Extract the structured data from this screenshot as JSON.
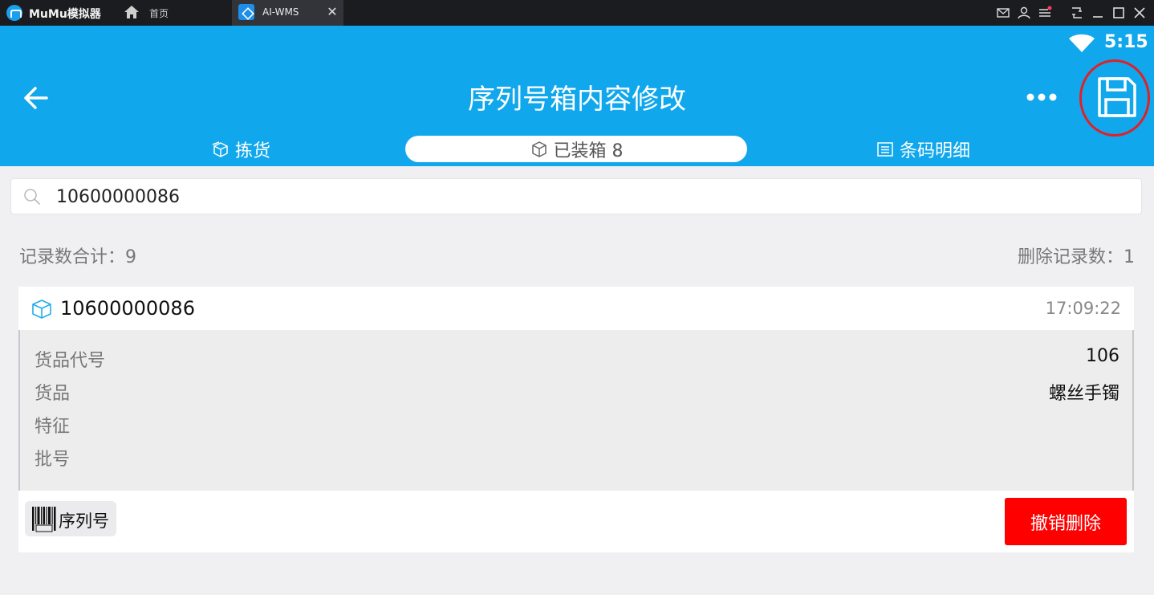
{
  "emulator": {
    "app_name": "MuMu模拟器",
    "home_tab_label": "首页",
    "active_tab_label": "AI-WMS",
    "tab_close_glyph": "✕",
    "icons": [
      "mail-icon",
      "user-icon",
      "menu-icon",
      "screen-rotate-icon",
      "minimize-icon",
      "maximize-icon",
      "close-icon"
    ]
  },
  "status_bar": {
    "time": "5:15"
  },
  "header": {
    "title": "序列号箱内容修改",
    "save_highlight_color": "#e02128",
    "tabs": [
      {
        "label": "拣货",
        "icon": "box-open-icon",
        "active": false
      },
      {
        "label": "已装箱 8",
        "icon": "box-icon",
        "active": true
      },
      {
        "label": "条码明细",
        "icon": "list-icon",
        "active": false
      }
    ]
  },
  "search": {
    "value": "10600000086"
  },
  "summary": {
    "total": "记录数合计：9",
    "deleted": "删除记录数：1"
  },
  "record": {
    "code": "10600000086",
    "time": "17:09:22",
    "fields": [
      {
        "label": "货品代号",
        "value": "106"
      },
      {
        "label": "货品",
        "value": "螺丝手镯"
      },
      {
        "label": "特征",
        "value": ""
      },
      {
        "label": "批号",
        "value": ""
      }
    ],
    "serial_label": "序列号",
    "undo_delete_label": "撤销删除"
  },
  "colors": {
    "primary": "#10a7ec",
    "danger": "#fe0000",
    "background": "#f0f0f3"
  }
}
